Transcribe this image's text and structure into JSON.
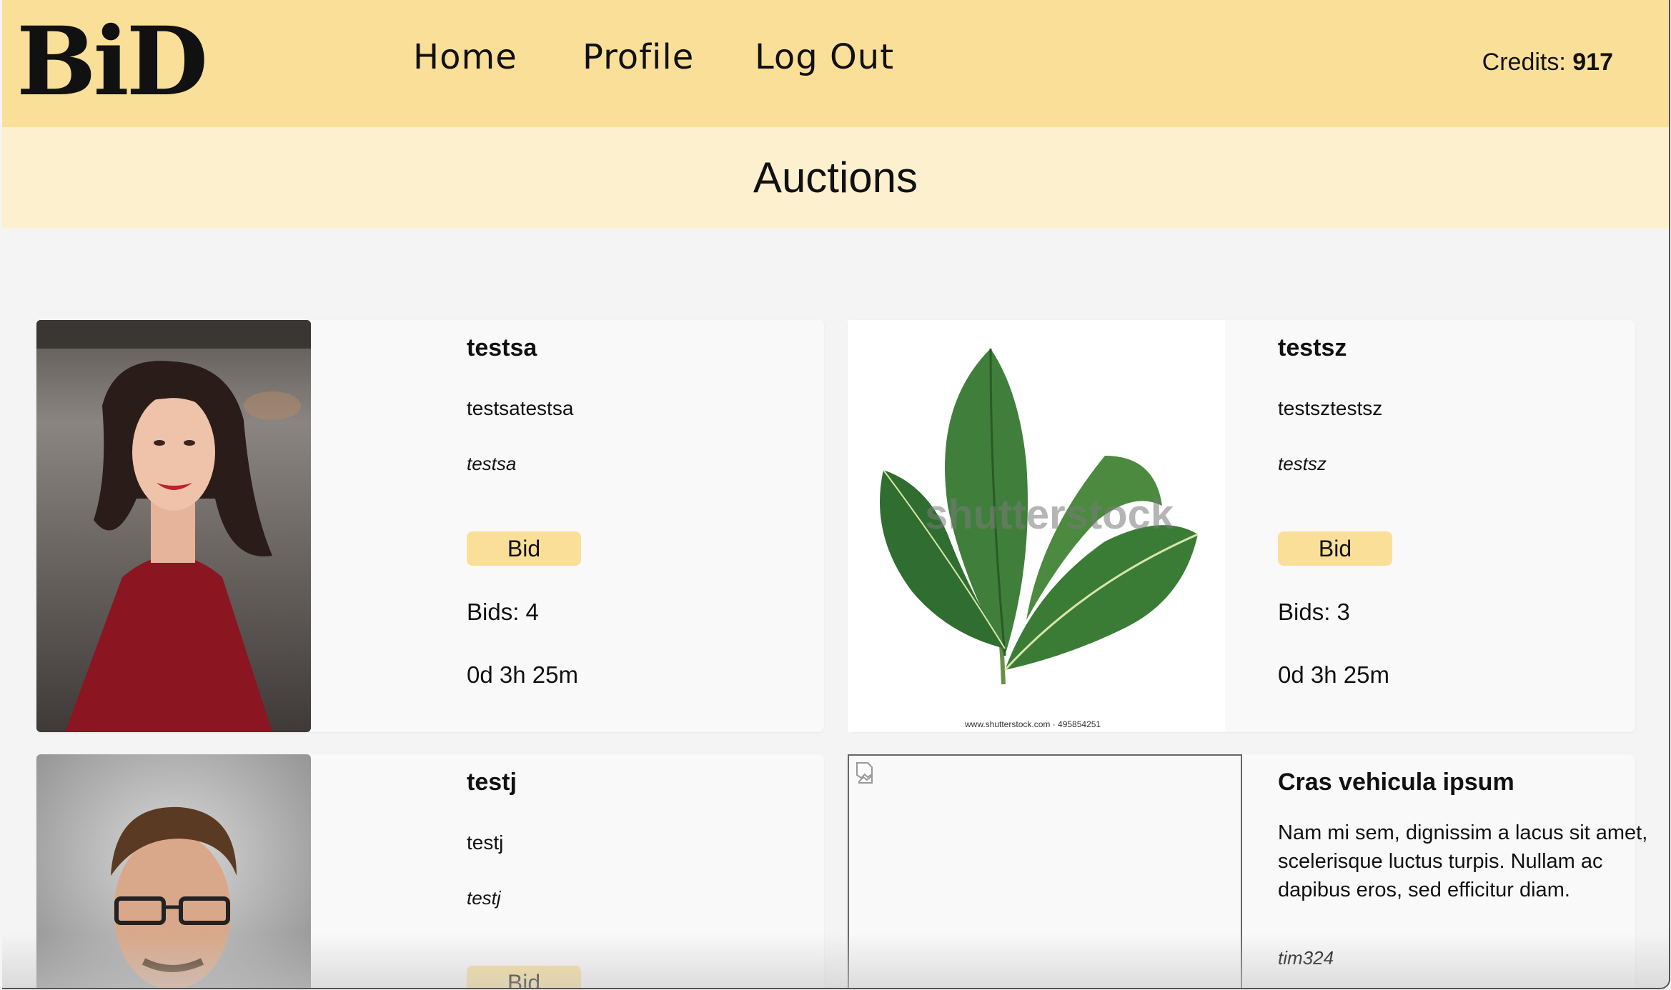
{
  "header": {
    "logo": "BiD",
    "nav": [
      "Home",
      "Profile",
      "Log Out"
    ],
    "credits_label": "Credits:",
    "credits_value": "917"
  },
  "page_title": "Auctions",
  "auctions": [
    {
      "name": "testsa",
      "description": "testsatestsa",
      "user": "testsa",
      "bid_label": "Bid",
      "bids": "Bids: 4",
      "time_left": "0d 3h 25m",
      "image": "woman-portrait"
    },
    {
      "name": "testsz",
      "description": "testsztestsz",
      "user": "testsz",
      "bid_label": "Bid",
      "bids": "Bids: 3",
      "time_left": "0d 3h 25m",
      "image": "plant-illustration",
      "watermark": "shutterstock",
      "watermark_caption": "www.shutterstock.com · 495854251"
    },
    {
      "name": "testj",
      "description": "testj",
      "user": "testj",
      "bid_label": "Bid",
      "image": "man-portrait"
    },
    {
      "name": "Cras vehicula ipsum",
      "description": "Nam mi sem, dignissim a lacus sit amet, scelerisque luctus turpis. Nullam ac dapibus eros, sed efficitur diam.",
      "user": "tim324",
      "image": "broken-image"
    }
  ],
  "colors": {
    "header": "#f9df98",
    "title_bar": "#fcf0cf",
    "bid_button": "#f9df98",
    "page_bg": "#f4f4f4"
  }
}
